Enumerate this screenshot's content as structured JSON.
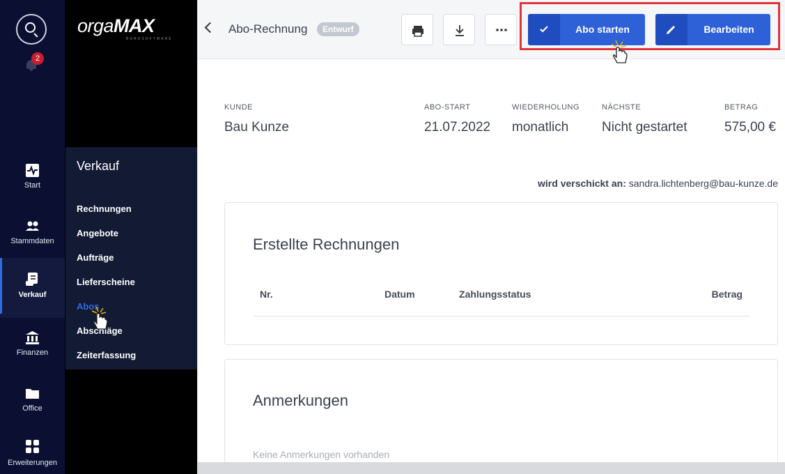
{
  "notifications": {
    "count": "2"
  },
  "rail": {
    "items": [
      {
        "label": "Start"
      },
      {
        "label": "Stammdaten"
      },
      {
        "label": "Verkauf"
      },
      {
        "label": "Finanzen"
      },
      {
        "label": "Office"
      },
      {
        "label": "Erweiterungen"
      }
    ]
  },
  "brand": {
    "logo_prefix": "orga",
    "logo_suffix": "MAX",
    "logo_sub": "BÜROSOFTWARE"
  },
  "flyout": {
    "title": "Verkauf",
    "items": [
      {
        "label": "Rechnungen"
      },
      {
        "label": "Angebote"
      },
      {
        "label": "Aufträge"
      },
      {
        "label": "Lieferscheine"
      },
      {
        "label": "Abos"
      },
      {
        "label": "Abschläge"
      },
      {
        "label": "Zeiterfassung"
      }
    ]
  },
  "header": {
    "title": "Abo-Rechnung",
    "status": "Entwurf",
    "start_label": "Abo starten",
    "edit_label": "Bearbeiten"
  },
  "meta": {
    "customer_label": "KUNDE",
    "customer": "Bau Kunze",
    "start_label": "ABO-START",
    "start": "21.07.2022",
    "repeat_label": "WIEDERHOLUNG",
    "repeat": "monatlich",
    "next_label": "NÄCHSTE",
    "next": "Nicht gestartet",
    "amount_label": "BETRAG",
    "amount": "575,00 €"
  },
  "sent_to": {
    "label": "wird verschickt an:",
    "email": "sandra.lichtenberg@bau-kunze.de"
  },
  "invoices": {
    "title": "Erstellte Rechnungen",
    "columns": [
      "Nr.",
      "Datum",
      "Zahlungsstatus",
      "Betrag"
    ]
  },
  "notes": {
    "title": "Anmerkungen",
    "empty": "Keine Anmerkungen vorhanden"
  },
  "colors": {
    "accent": "#2e60d8",
    "rail_bg": "#0b1032",
    "highlight": "#e3333a",
    "badge": "#c8202f"
  }
}
